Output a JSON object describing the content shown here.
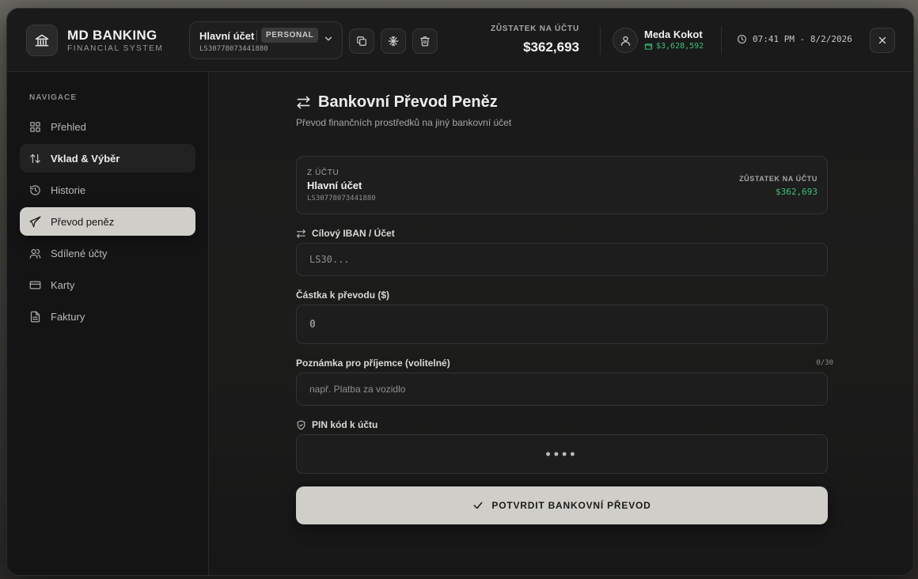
{
  "brand": {
    "title": "MD BANKING",
    "subtitle": "FINANCIAL SYSTEM"
  },
  "account_selector": {
    "name": "Hlavní účet",
    "badge": "PERSONAL",
    "iban": "LS30778073441880"
  },
  "header": {
    "balance_label": "ZŮSTATEK NA ÚČTU",
    "balance_value": "$362,693",
    "user_name": "Meda Kokot",
    "user_cash": "$3,628,592",
    "clock": "07:41 PM - 8/2/2026"
  },
  "colors": {
    "accent_green": "#3ec07a",
    "active_nav_bg": "#cfcec9",
    "panel_bg": "#151515"
  },
  "sidebar": {
    "title": "NAVIGACE",
    "items": [
      {
        "label": "Přehled",
        "icon": "grid-icon"
      },
      {
        "label": "Vklad & Výběr",
        "icon": "arrows-updown-icon"
      },
      {
        "label": "Historie",
        "icon": "history-icon"
      },
      {
        "label": "Převod peněz",
        "icon": "send-icon"
      },
      {
        "label": "Sdílené účty",
        "icon": "users-icon"
      },
      {
        "label": "Karty",
        "icon": "card-icon"
      },
      {
        "label": "Faktury",
        "icon": "document-icon"
      }
    ]
  },
  "transfer": {
    "title": "Bankovní Převod Peněz",
    "subtitle": "Převod finančních prostředků na jiný bankovní účet",
    "from": {
      "label": "Z ÚČTU",
      "name": "Hlavní účet",
      "iban": "LS30778073441880",
      "balance_label": "ZŮSTATEK NA ÚČTU",
      "balance": "$362,693"
    },
    "iban_label": "Cílový IBAN / Účet",
    "iban_placeholder": "LS30...",
    "amount_label": "Částka k převodu ($)",
    "amount_placeholder": "0",
    "note_label": "Poznámka pro příjemce (volitelné)",
    "note_counter": "0/30",
    "note_placeholder": "např. Platba za vozidlo",
    "pin_label": "PIN kód k účtu",
    "pin_placeholder": "••••",
    "submit_label": "POTVRDIT BANKOVNÍ PŘEVOD"
  }
}
